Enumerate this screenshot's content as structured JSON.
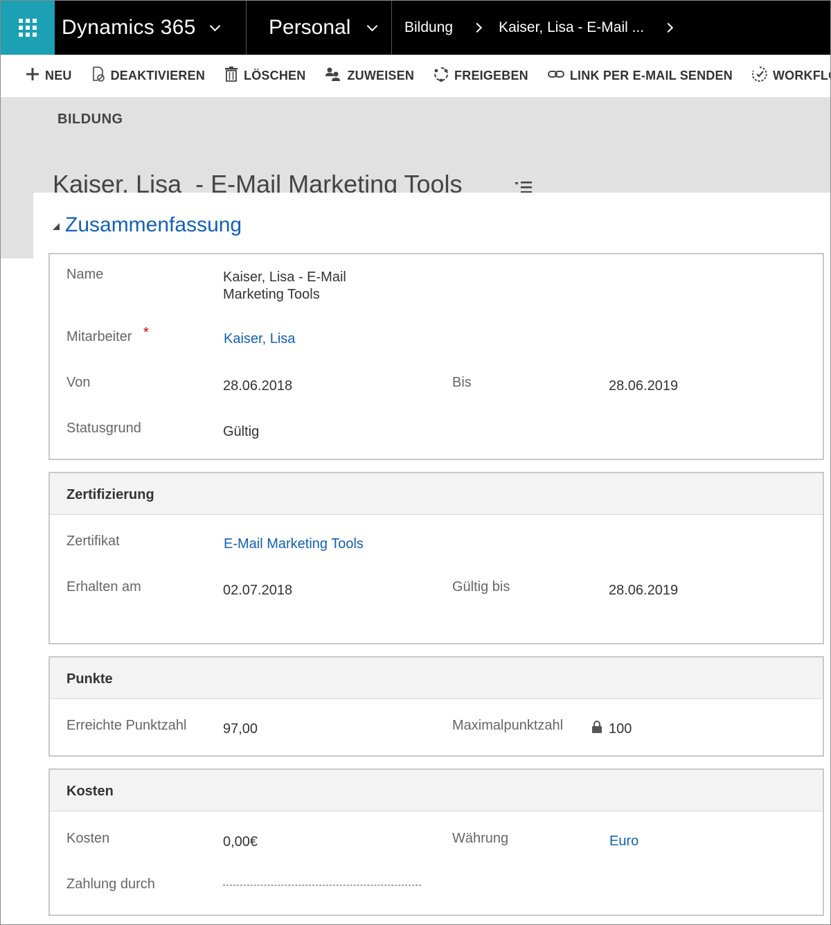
{
  "nav": {
    "app_name": "Dynamics 365",
    "area_name": "Personal",
    "breadcrumb": [
      "Bildung",
      "Kaiser, Lisa  - E-Mail ..."
    ]
  },
  "commands": [
    {
      "label": "NEU",
      "icon": "plus-icon"
    },
    {
      "label": "DEAKTIVIEREN",
      "icon": "deactivate-icon"
    },
    {
      "label": "LÖSCHEN",
      "icon": "trash-icon"
    },
    {
      "label": "ZUWEISEN",
      "icon": "assign-icon"
    },
    {
      "label": "FREIGEBEN",
      "icon": "share-icon"
    },
    {
      "label": "LINK PER E-MAIL SENDEN",
      "icon": "link-icon"
    },
    {
      "label": "WORKFLOW AUS",
      "icon": "workflow-icon"
    }
  ],
  "header": {
    "entity": "BILDUNG",
    "title": "Kaiser, Lisa  - E-Mail Marketing Tools"
  },
  "tab": {
    "label": "Zusammenfassung"
  },
  "summary": {
    "name_label": "Name",
    "name_value_line1": "Kaiser, Lisa  - E-Mail",
    "name_value_line2": "Marketing Tools",
    "employee_label": "Mitarbeiter",
    "required_mark": "*",
    "employee_value": "Kaiser, Lisa",
    "from_label": "Von",
    "from_value": "28.06.2018",
    "to_label": "Bis",
    "to_value": "28.06.2019",
    "status_label": "Statusgrund",
    "status_value": "Gültig"
  },
  "certification": {
    "title": "Zertifizierung",
    "cert_label": "Zertifikat",
    "cert_value": "E-Mail Marketing Tools",
    "received_label": "Erhalten am",
    "received_value": "02.07.2018",
    "valid_label": "Gültig bis",
    "valid_value": "28.06.2019"
  },
  "points": {
    "title": "Punkte",
    "achieved_label": "Erreichte Punktzahl",
    "achieved_value": "97,00",
    "max_label": "Maximalpunktzahl",
    "max_value": "100"
  },
  "costs": {
    "title": "Kosten",
    "cost_label": "Kosten",
    "cost_value": "0,00€",
    "currency_label": "Währung",
    "currency_value": "Euro",
    "payment_label": "Zahlung durch"
  },
  "colors": {
    "nav_bg": "#000000",
    "waffle_bg": "#1ba0b4",
    "link": "#1160b7",
    "header_band": "#e1e1e1"
  }
}
